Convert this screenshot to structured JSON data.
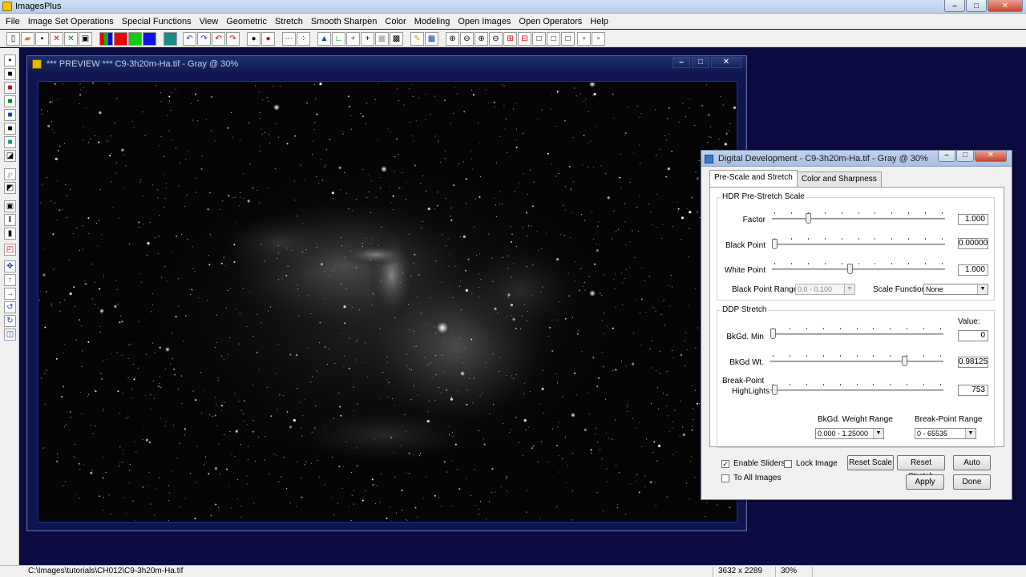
{
  "app": {
    "title": "ImagesPlus",
    "title_extra": "C9-3h20m-Ha.tif - Gray @ 30%"
  },
  "window_controls": {
    "minimize": "–",
    "maximize": "□",
    "close": "✕"
  },
  "menu": [
    "File",
    "Image Set Operations",
    "Special Functions",
    "View",
    "Geometric",
    "Stretch",
    "Smooth Sharpen",
    "Color",
    "Modeling",
    "Open Images",
    "Open Operators",
    "Help"
  ],
  "preview": {
    "title": "*** PREVIEW *** C9-3h20m-Ha.tif - Gray @ 30%"
  },
  "dialog": {
    "title": "Digital Development - C9-3h20m-Ha.tif - Gray @ 30%",
    "tabs": [
      "Pre-Scale and Stretch",
      "Color and Sharpness"
    ],
    "active_tab": "Pre-Scale and Stretch",
    "hdr": {
      "group_title": "HDR Pre-Stretch Scale",
      "factor_label": "Factor",
      "factor_value": "1.000",
      "factor_level": 0.2,
      "black_point_label": "Black Point",
      "black_point_value": "0.00000",
      "black_point_level": 0.0,
      "white_point_label": "White Point",
      "white_point_value": "1.000",
      "white_point_level": 0.45,
      "black_point_range_label": "Black Point Range",
      "black_point_range_value": "0.0 - 0.100",
      "scale_function_label": "Scale Function",
      "scale_function_value": "None"
    },
    "ddp": {
      "group_title": "DDP Stretch",
      "value_header": "Value:",
      "bkgd_min_label": "BkGd. Min",
      "bkgd_min_value": "0",
      "bkgd_min_level": 0.0,
      "bkgd_wt_label": "BkGd Wt.",
      "bkgd_wt_value": "0.98125",
      "bkgd_wt_level": 0.785,
      "break_point_label_1": "Break-Point",
      "break_point_label_2": "HighLights",
      "break_point_value": "753",
      "break_point_level": 0.01,
      "weight_range_label": "BkGd. Weight Range",
      "weight_range_value": "0.000 - 1.25000",
      "break_point_range_label": "Break-Point Range",
      "break_point_range_value": "0 - 65535"
    },
    "options": {
      "enable_sliders": "Enable Sliders",
      "enable_sliders_checked": true,
      "lock_image": "Lock Image",
      "lock_image_checked": false,
      "to_all_images": "To All Images",
      "to_all_images_checked": false
    },
    "buttons": {
      "reset_scale": "Reset Scale",
      "reset_stretch": "Reset Stretch",
      "auto": "Auto",
      "apply": "Apply",
      "done": "Done"
    }
  },
  "status": {
    "path": "C:\\Images\\tutorials\\CH012\\C9-3h20m-Ha.tif",
    "dimensions": "3632 x 2289",
    "zoom": "30%"
  }
}
